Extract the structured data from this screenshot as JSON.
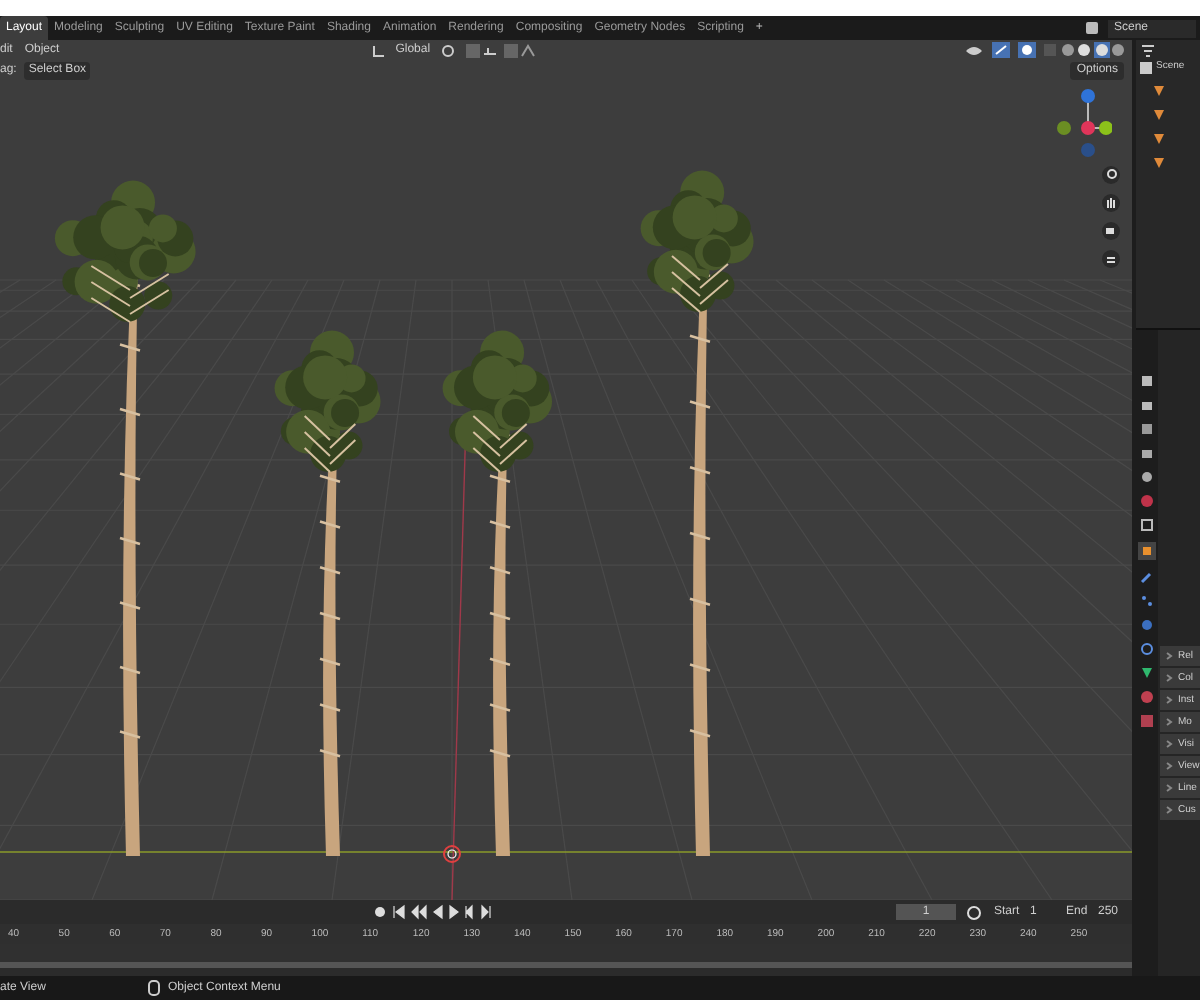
{
  "tabs": [
    {
      "label": "Layout",
      "selected": true
    },
    {
      "label": "Modeling",
      "selected": false
    },
    {
      "label": "Sculpting",
      "selected": false
    },
    {
      "label": "UV Editing",
      "selected": false
    },
    {
      "label": "Texture Paint",
      "selected": false
    },
    {
      "label": "Shading",
      "selected": false
    },
    {
      "label": "Animation",
      "selected": false
    },
    {
      "label": "Rendering",
      "selected": false
    },
    {
      "label": "Compositing",
      "selected": false
    },
    {
      "label": "Geometry Nodes",
      "selected": false
    },
    {
      "label": "Scripting",
      "selected": false
    }
  ],
  "add_workspace": "+",
  "scene": "Scene",
  "viewport": {
    "menus": [
      "dit",
      "Object"
    ],
    "tool_label": "ag:",
    "tool": "Select Box",
    "orientation": "Global",
    "options": "Options"
  },
  "outliner": {
    "root": "Scene"
  },
  "properties": {
    "panels": [
      {
        "label": "Rel",
        "expanded": false
      },
      {
        "label": "Col",
        "expanded": false
      },
      {
        "label": "Inst",
        "expanded": false
      },
      {
        "label": "Mo",
        "expanded": false
      },
      {
        "label": "Visi",
        "expanded": false
      },
      {
        "label": "View",
        "expanded": false
      },
      {
        "label": "Line",
        "expanded": false
      },
      {
        "label": "Cus",
        "expanded": false
      }
    ]
  },
  "timeline": {
    "current_frame": "1",
    "start_label": "Start",
    "start": "1",
    "end_label": "End",
    "end": "250",
    "ruler": [
      "40",
      "50",
      "60",
      "70",
      "80",
      "90",
      "100",
      "110",
      "120",
      "130",
      "140",
      "150",
      "160",
      "170",
      "180",
      "190",
      "200",
      "210",
      "220",
      "230",
      "240",
      "250"
    ]
  },
  "status_bar": [
    "ate View",
    "Object Context Menu"
  ]
}
